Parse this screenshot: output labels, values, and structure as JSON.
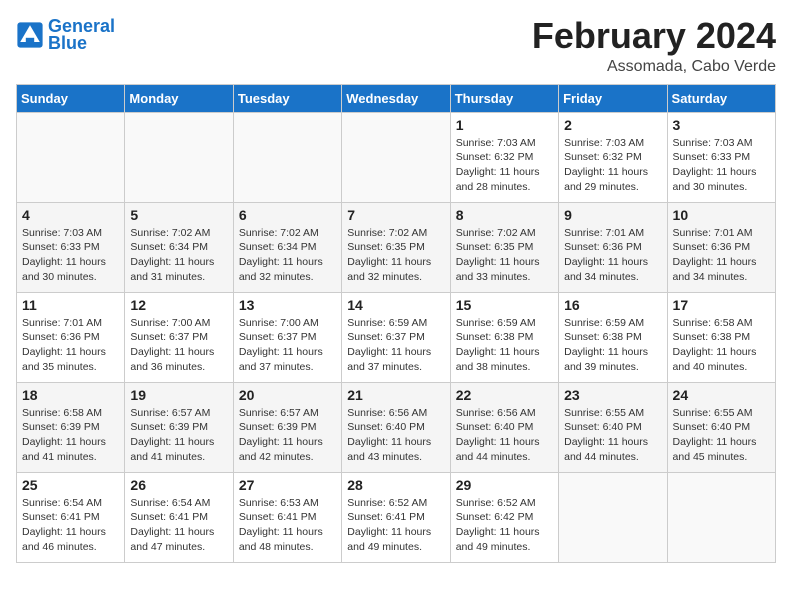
{
  "header": {
    "logo_line1": "General",
    "logo_line2": "Blue",
    "month": "February 2024",
    "location": "Assomada, Cabo Verde"
  },
  "weekdays": [
    "Sunday",
    "Monday",
    "Tuesday",
    "Wednesday",
    "Thursday",
    "Friday",
    "Saturday"
  ],
  "weeks": [
    [
      {
        "day": "",
        "info": ""
      },
      {
        "day": "",
        "info": ""
      },
      {
        "day": "",
        "info": ""
      },
      {
        "day": "",
        "info": ""
      },
      {
        "day": "1",
        "info": "Sunrise: 7:03 AM\nSunset: 6:32 PM\nDaylight: 11 hours\nand 28 minutes."
      },
      {
        "day": "2",
        "info": "Sunrise: 7:03 AM\nSunset: 6:32 PM\nDaylight: 11 hours\nand 29 minutes."
      },
      {
        "day": "3",
        "info": "Sunrise: 7:03 AM\nSunset: 6:33 PM\nDaylight: 11 hours\nand 30 minutes."
      }
    ],
    [
      {
        "day": "4",
        "info": "Sunrise: 7:03 AM\nSunset: 6:33 PM\nDaylight: 11 hours\nand 30 minutes."
      },
      {
        "day": "5",
        "info": "Sunrise: 7:02 AM\nSunset: 6:34 PM\nDaylight: 11 hours\nand 31 minutes."
      },
      {
        "day": "6",
        "info": "Sunrise: 7:02 AM\nSunset: 6:34 PM\nDaylight: 11 hours\nand 32 minutes."
      },
      {
        "day": "7",
        "info": "Sunrise: 7:02 AM\nSunset: 6:35 PM\nDaylight: 11 hours\nand 32 minutes."
      },
      {
        "day": "8",
        "info": "Sunrise: 7:02 AM\nSunset: 6:35 PM\nDaylight: 11 hours\nand 33 minutes."
      },
      {
        "day": "9",
        "info": "Sunrise: 7:01 AM\nSunset: 6:36 PM\nDaylight: 11 hours\nand 34 minutes."
      },
      {
        "day": "10",
        "info": "Sunrise: 7:01 AM\nSunset: 6:36 PM\nDaylight: 11 hours\nand 34 minutes."
      }
    ],
    [
      {
        "day": "11",
        "info": "Sunrise: 7:01 AM\nSunset: 6:36 PM\nDaylight: 11 hours\nand 35 minutes."
      },
      {
        "day": "12",
        "info": "Sunrise: 7:00 AM\nSunset: 6:37 PM\nDaylight: 11 hours\nand 36 minutes."
      },
      {
        "day": "13",
        "info": "Sunrise: 7:00 AM\nSunset: 6:37 PM\nDaylight: 11 hours\nand 37 minutes."
      },
      {
        "day": "14",
        "info": "Sunrise: 6:59 AM\nSunset: 6:37 PM\nDaylight: 11 hours\nand 37 minutes."
      },
      {
        "day": "15",
        "info": "Sunrise: 6:59 AM\nSunset: 6:38 PM\nDaylight: 11 hours\nand 38 minutes."
      },
      {
        "day": "16",
        "info": "Sunrise: 6:59 AM\nSunset: 6:38 PM\nDaylight: 11 hours\nand 39 minutes."
      },
      {
        "day": "17",
        "info": "Sunrise: 6:58 AM\nSunset: 6:38 PM\nDaylight: 11 hours\nand 40 minutes."
      }
    ],
    [
      {
        "day": "18",
        "info": "Sunrise: 6:58 AM\nSunset: 6:39 PM\nDaylight: 11 hours\nand 41 minutes."
      },
      {
        "day": "19",
        "info": "Sunrise: 6:57 AM\nSunset: 6:39 PM\nDaylight: 11 hours\nand 41 minutes."
      },
      {
        "day": "20",
        "info": "Sunrise: 6:57 AM\nSunset: 6:39 PM\nDaylight: 11 hours\nand 42 minutes."
      },
      {
        "day": "21",
        "info": "Sunrise: 6:56 AM\nSunset: 6:40 PM\nDaylight: 11 hours\nand 43 minutes."
      },
      {
        "day": "22",
        "info": "Sunrise: 6:56 AM\nSunset: 6:40 PM\nDaylight: 11 hours\nand 44 minutes."
      },
      {
        "day": "23",
        "info": "Sunrise: 6:55 AM\nSunset: 6:40 PM\nDaylight: 11 hours\nand 44 minutes."
      },
      {
        "day": "24",
        "info": "Sunrise: 6:55 AM\nSunset: 6:40 PM\nDaylight: 11 hours\nand 45 minutes."
      }
    ],
    [
      {
        "day": "25",
        "info": "Sunrise: 6:54 AM\nSunset: 6:41 PM\nDaylight: 11 hours\nand 46 minutes."
      },
      {
        "day": "26",
        "info": "Sunrise: 6:54 AM\nSunset: 6:41 PM\nDaylight: 11 hours\nand 47 minutes."
      },
      {
        "day": "27",
        "info": "Sunrise: 6:53 AM\nSunset: 6:41 PM\nDaylight: 11 hours\nand 48 minutes."
      },
      {
        "day": "28",
        "info": "Sunrise: 6:52 AM\nSunset: 6:41 PM\nDaylight: 11 hours\nand 49 minutes."
      },
      {
        "day": "29",
        "info": "Sunrise: 6:52 AM\nSunset: 6:42 PM\nDaylight: 11 hours\nand 49 minutes."
      },
      {
        "day": "",
        "info": ""
      },
      {
        "day": "",
        "info": ""
      }
    ]
  ]
}
